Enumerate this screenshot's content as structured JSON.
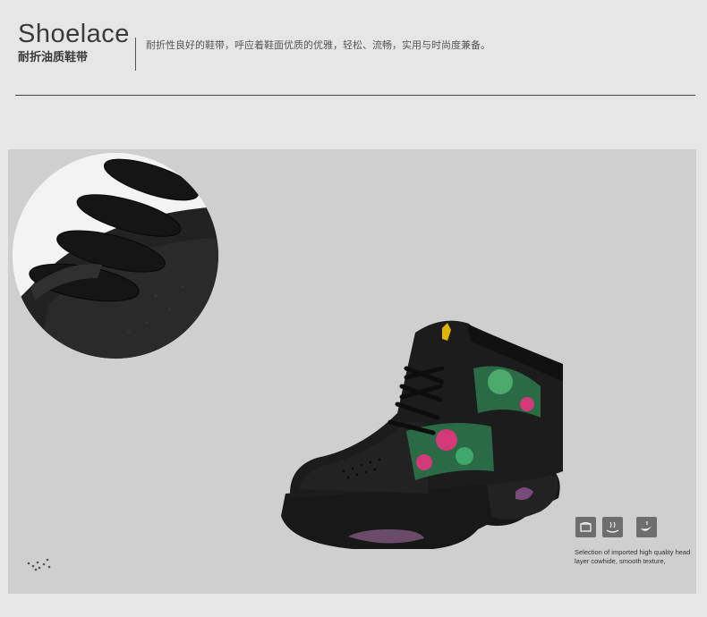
{
  "header": {
    "title": "Shoelace",
    "subtitle": "耐折油质鞋带",
    "description": "耐折性良好的鞋带，呼应着鞋面优质的优雅，轻松、流畅，实用与时尚度兼备。"
  },
  "feature": {
    "icons": [
      "leather-icon",
      "comfort-icon",
      "sole-icon"
    ],
    "caption_line1": "Selection of imported high quality head",
    "caption_line2": "layer cowhide, smooth texture,"
  },
  "colors": {
    "page_bg": "#e6e6e6",
    "panel_bg": "#cfcfcf",
    "text_dark": "#3a3a3a",
    "icon_bg": "#6e6e6e"
  }
}
